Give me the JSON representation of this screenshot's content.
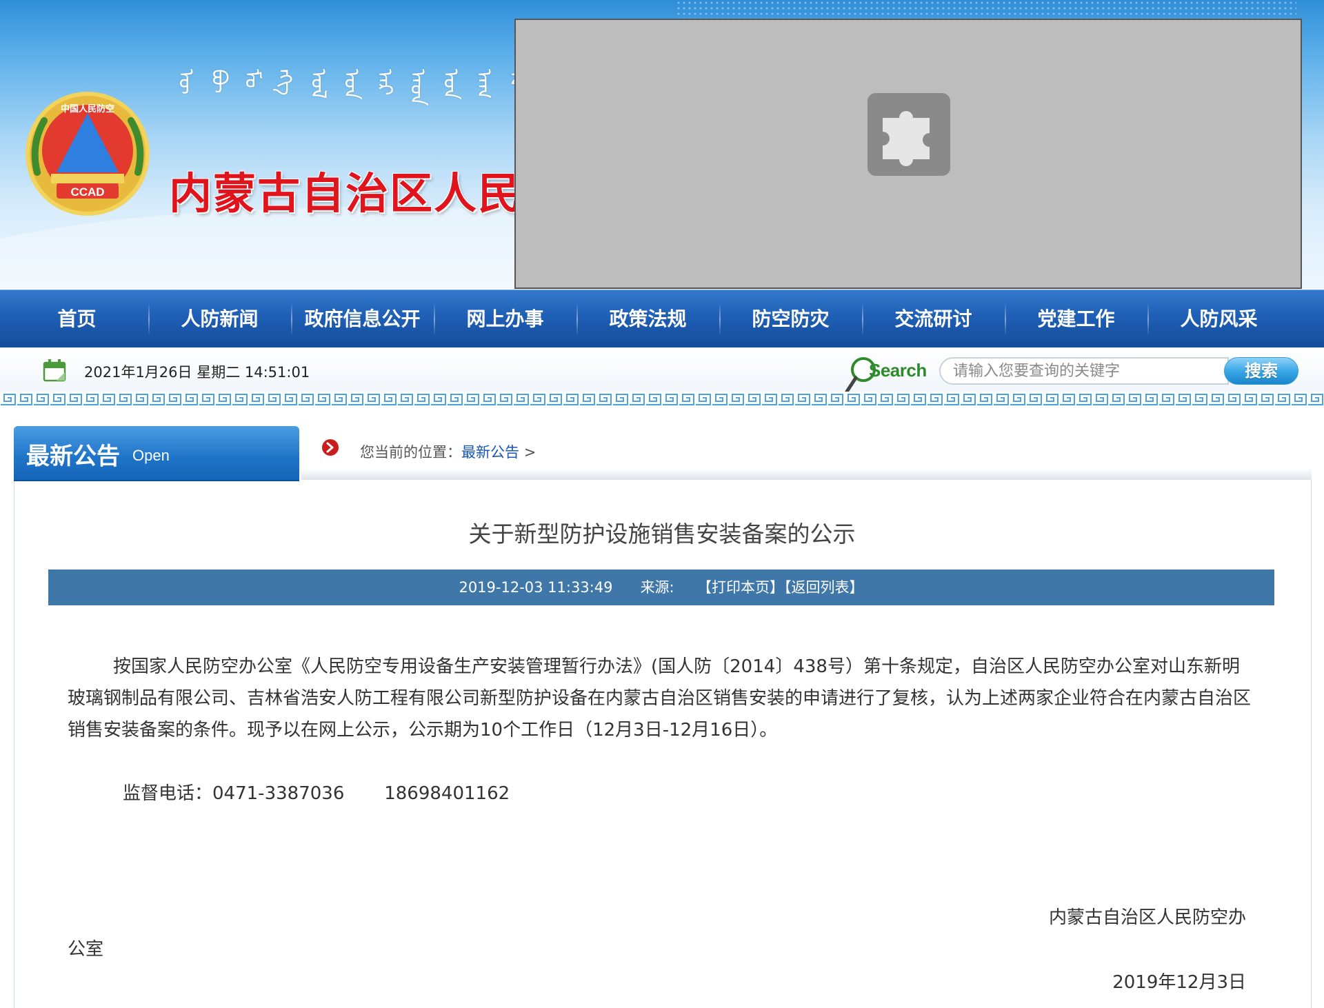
{
  "header": {
    "site_title": "内蒙古自治区人民防空办公室",
    "emblem_text": "CCAD",
    "emblem_ring_text": "中国人民防空",
    "mongolian_script": [
      "ᠥ",
      "ᠪᠦ",
      "ᠮᠣ",
      "ᠩᠭ",
      "ᠣᠯ",
      "ᠤᠨ",
      "ᠠᠷ",
      "ᠠᠳ",
      "ᠤᠨ",
      "ᠠᠭ",
      "ᠠ"
    ]
  },
  "nav": {
    "items": [
      {
        "label": "首页"
      },
      {
        "label": "人防新闻"
      },
      {
        "label": "政府信息公开"
      },
      {
        "label": "网上办事"
      },
      {
        "label": "政策法规"
      },
      {
        "label": "防空防灾"
      },
      {
        "label": "交流研讨"
      },
      {
        "label": "党建工作"
      },
      {
        "label": "人防风采"
      }
    ]
  },
  "toolbar": {
    "datetime": "2021年1月26日 星期二 14:51:01",
    "search_logo": "Search",
    "search_placeholder": "请输入您要查询的关键字",
    "search_button": "搜索"
  },
  "section": {
    "title": "最新公告",
    "subtitle": "Open"
  },
  "breadcrumb": {
    "prefix": "您当前的位置：",
    "current": "最新公告",
    "separator": ">"
  },
  "article": {
    "title": "关于新型防护设施销售安装备案的公示",
    "meta": {
      "datetime": "2019-12-03 11:33:49",
      "source_label": "来源:",
      "print_label": "【打印本页】",
      "back_label": "【返回列表】"
    },
    "body": "按国家人民防空办公室《人民防空专用设备生产安装管理暂行办法》(国人防〔2014〕438号）第十条规定，自治区人民防空办公室对山东新明玻璃钢制品有限公司、吉林省浩安人防工程有限公司新型防护设备在内蒙古自治区销售安装的申请进行了复核，认为上述两家企业符合在内蒙古自治区销售安装备案的条件。现予以在网上公示，公示期为10个工作日（12月3日-12月16日）。",
    "phone_label": "监督电话：",
    "phone_1": "0471-3387036",
    "phone_2": "18698401162",
    "signature_line_1": "内蒙古自治区人民防空办",
    "signature_line_2": "公室",
    "signature_date": "2019年12月3日"
  },
  "colors": {
    "nav_blue": "#1e5fb5",
    "title_red": "#e0141c",
    "meta_bar": "#3f78a8",
    "link_blue": "#1a56b8"
  }
}
